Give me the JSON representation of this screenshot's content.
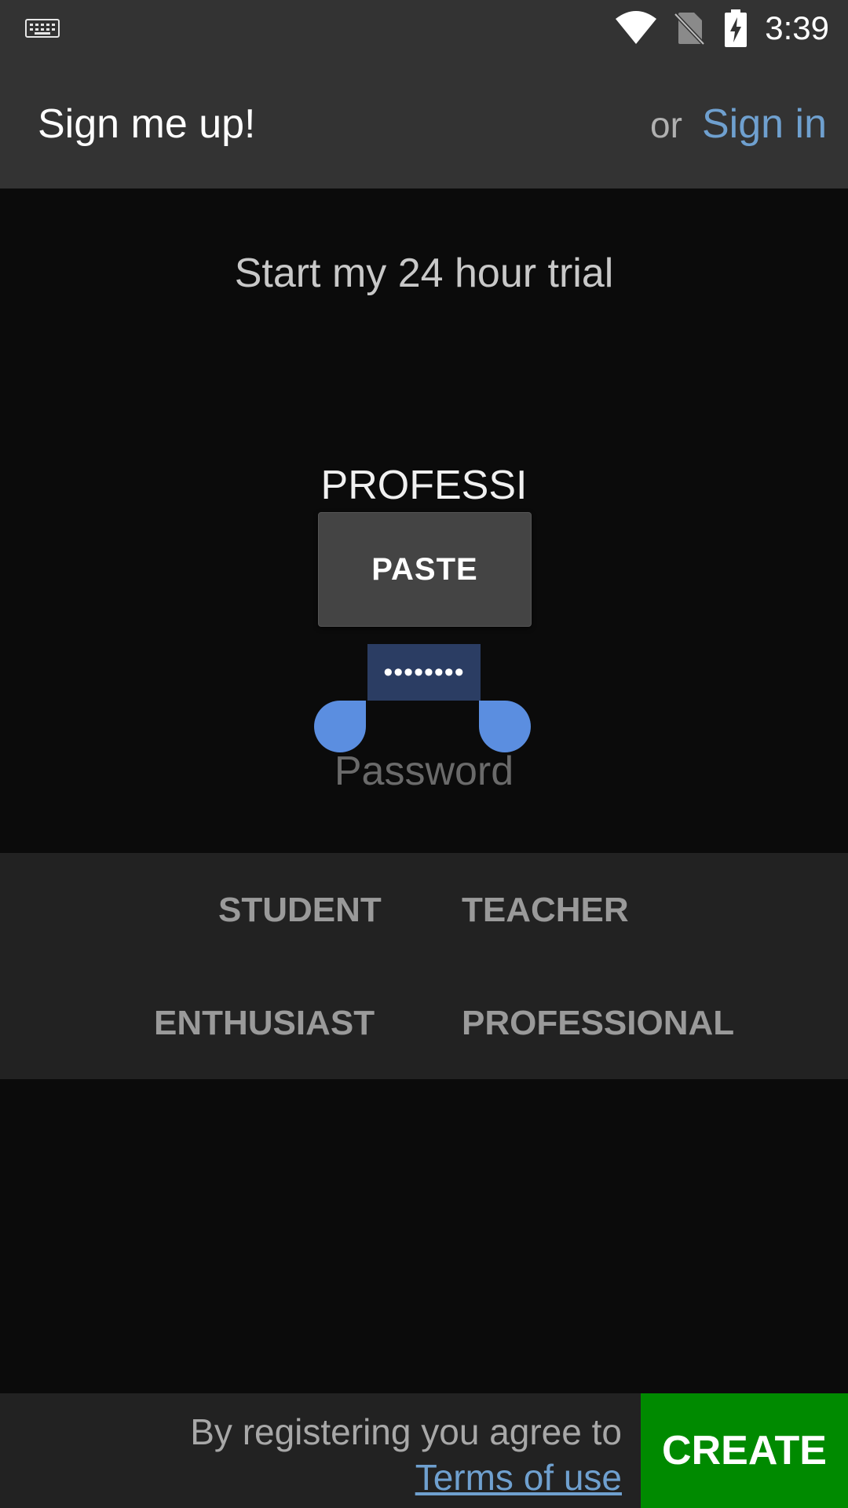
{
  "status_bar": {
    "time": "3:39",
    "icons": [
      "keyboard-icon",
      "wifi-icon",
      "no-sim-icon",
      "battery-charging-icon"
    ]
  },
  "app_bar": {
    "title": "Sign me up!",
    "or_label": "or",
    "signin_label": "Sign in"
  },
  "main": {
    "trial_text": "Start my 24 hour trial",
    "username_value": "PROFESSI",
    "paste_label": "PASTE",
    "password_masked": "••••••••",
    "password_placeholder": "Password"
  },
  "roles": {
    "student": "STUDENT",
    "teacher": "TEACHER",
    "enthusiast": "ENTHUSIAST",
    "professional": "PROFESSIONAL"
  },
  "footer": {
    "agree_text": "By registering you agree to",
    "terms_label": "Terms of use",
    "create_label": "CREATE"
  },
  "colors": {
    "link": "#6fa0cf",
    "create_button": "#008a00",
    "selection_handle": "#5b8ee0"
  }
}
